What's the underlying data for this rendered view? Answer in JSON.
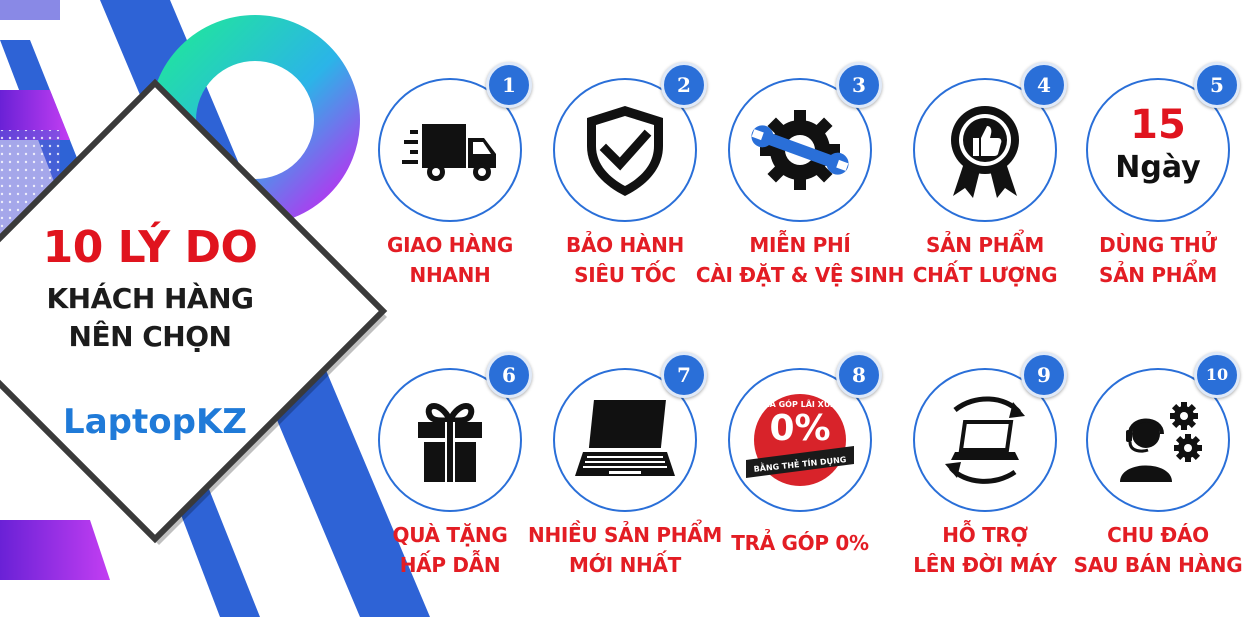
{
  "heading": {
    "line1": "10 LÝ DO",
    "line2": "KHÁCH HÀNG",
    "line3": "NÊN CHỌN"
  },
  "brand": "LaptopKZ",
  "colors": {
    "accent_blue": "#2a6fd8",
    "accent_red": "#e31d24",
    "panel_purple": "#8a2be2",
    "ring_green": "#2fe08a"
  },
  "items": [
    {
      "number": "1",
      "icon": "delivery-truck-icon",
      "lines": [
        "GIAO HÀNG",
        "NHANH"
      ]
    },
    {
      "number": "2",
      "icon": "shield-check-icon",
      "lines": [
        "BẢO HÀNH",
        "SIÊU TỐC"
      ]
    },
    {
      "number": "3",
      "icon": "wrench-gear-icon",
      "lines": [
        "MIỄN PHÍ",
        "CÀI ĐẶT & VỆ SINH"
      ]
    },
    {
      "number": "4",
      "icon": "quality-badge-icon",
      "lines": [
        "SẢN PHẨM",
        "CHẤT LƯỢNG"
      ]
    },
    {
      "number": "5",
      "icon": "fifteen-days-icon",
      "lines": [
        "DÙNG THỬ",
        "SẢN PHẨM"
      ],
      "icon_text": [
        "15",
        "Ngày"
      ]
    },
    {
      "number": "6",
      "icon": "gift-box-icon",
      "lines": [
        "QUÀ TẶNG",
        "HẤP DẪN"
      ]
    },
    {
      "number": "7",
      "icon": "laptop-icon",
      "lines": [
        "NHIỀU SẢN PHẨM",
        "MỚI NHẤT"
      ]
    },
    {
      "number": "8",
      "icon": "zero-percent-badge-icon",
      "lines": [
        "TRẢ GÓP 0%"
      ],
      "icon_text": [
        "TRẢ GÓP LÃI XUẤT",
        "0%",
        "BẰNG THẺ TÍN DỤNG"
      ]
    },
    {
      "number": "9",
      "icon": "laptop-upgrade-arrows-icon",
      "lines": [
        "HỖ TRỢ",
        "LÊN ĐỜI MÁY"
      ]
    },
    {
      "number": "10",
      "icon": "support-agent-gears-icon",
      "lines": [
        "CHU ĐÁO",
        "SAU BÁN HÀNG"
      ]
    }
  ]
}
